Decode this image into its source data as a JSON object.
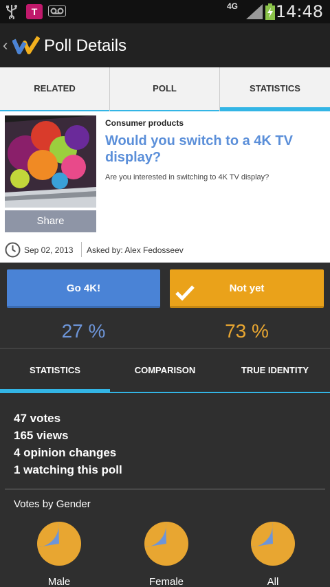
{
  "status_bar": {
    "network": "4G",
    "time": "14:48",
    "carrier_badge": "T"
  },
  "action_bar": {
    "title": "Poll Details"
  },
  "top_tabs": [
    {
      "label": "RELATED"
    },
    {
      "label": "POLL"
    },
    {
      "label": "STATISTICS",
      "active": true
    }
  ],
  "poll": {
    "category": "Consumer products",
    "question": "Would you switch to a 4K TV display?",
    "subtitle": "Are you interested in switching to 4K TV display?",
    "share_label": "Share",
    "date": "Sep 02, 2013",
    "asked_by": "Asked by: Alex Fedosseev"
  },
  "options": [
    {
      "label": "Go 4K!",
      "percent": "27 %",
      "color": "#4a83d6"
    },
    {
      "label": "Not yet",
      "percent": "73 %",
      "color": "#eaa21a",
      "selected": true
    }
  ],
  "stat_tabs": [
    {
      "label": "STATISTICS",
      "active": true
    },
    {
      "label": "COMPARISON"
    },
    {
      "label": "TRUE IDENTITY"
    }
  ],
  "stats": {
    "votes": "47  votes",
    "views": "165  views",
    "opinion_changes": "4  opinion changes",
    "watching": "1  watching this poll"
  },
  "votes_by_gender": {
    "title": "Votes by Gender",
    "pies": [
      {
        "label": "Male",
        "share_go": 0.27
      },
      {
        "label": "Female",
        "share_go": 0.27
      },
      {
        "label": "All",
        "share_go": 0.27
      }
    ]
  },
  "colors": {
    "accent": "#33b5e5",
    "go": "#6d95d8",
    "not": "#e8a631"
  }
}
